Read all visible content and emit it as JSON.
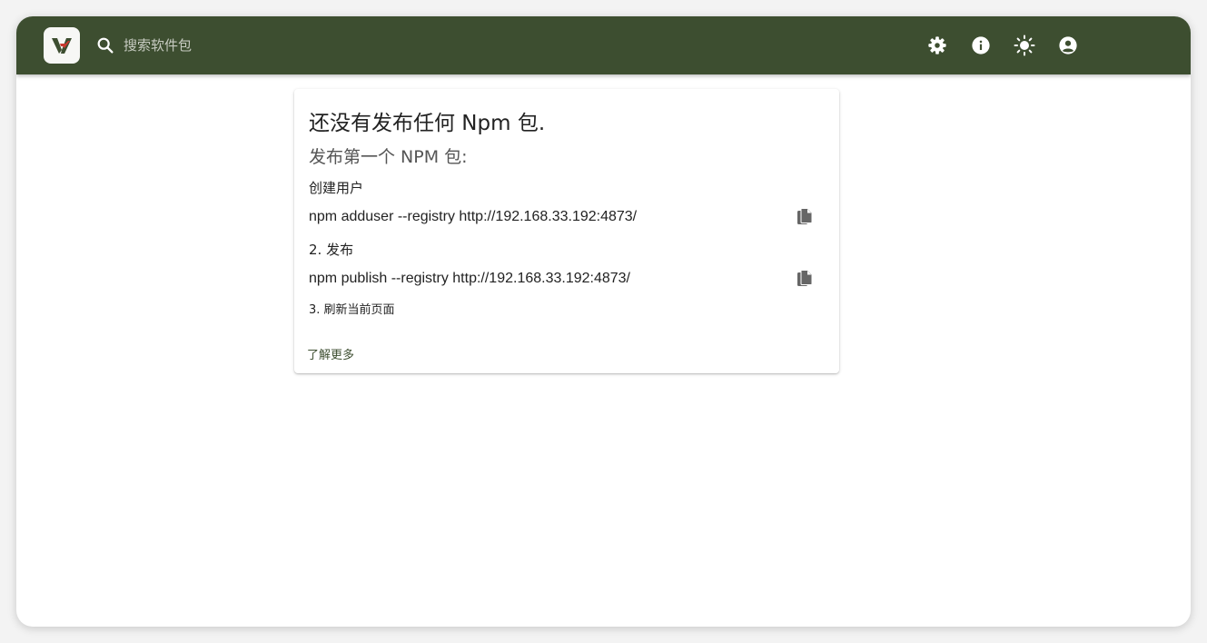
{
  "header": {
    "logo_icon": "verdaccio-logo-icon",
    "search": {
      "placeholder": "搜索软件包",
      "value": "",
      "icon": "search-icon"
    },
    "actions": [
      {
        "name": "settings",
        "icon": "gear-icon"
      },
      {
        "name": "info",
        "icon": "info-icon"
      },
      {
        "name": "theme",
        "icon": "sun-icon"
      },
      {
        "name": "account",
        "icon": "account-circle-icon"
      }
    ],
    "colors": {
      "background": "#3d4e30",
      "icon": "#ffffff"
    }
  },
  "card": {
    "title": "还没有发布任何 Npm 包.",
    "subtitle": "发布第一个 NPM 包:",
    "steps": {
      "create_user_label": "创建用户",
      "adduser_command": "npm adduser --registry http://192.168.33.192:4873/",
      "publish_label": "2. 发布",
      "publish_command": "npm publish --registry http://192.168.33.192:4873/",
      "refresh_label": "3. 刷新当前页面"
    },
    "learn_more": "了解更多",
    "copy_icon": "copy-icon"
  }
}
